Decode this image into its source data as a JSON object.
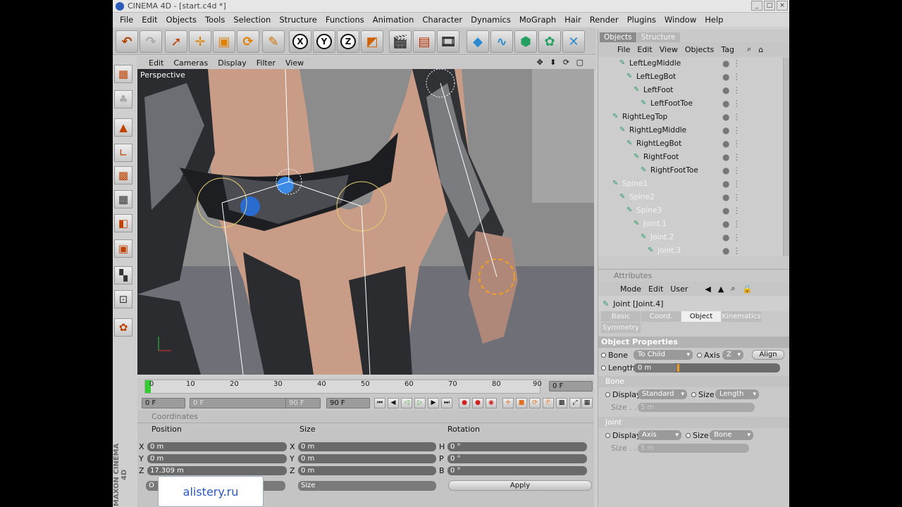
{
  "window": {
    "title": "CINEMA 4D - [start.c4d *]"
  },
  "menu": [
    "File",
    "Edit",
    "Objects",
    "Tools",
    "Selection",
    "Structure",
    "Functions",
    "Animation",
    "Character",
    "Dynamics",
    "MoGraph",
    "Hair",
    "Render",
    "Plugins",
    "Window",
    "Help"
  ],
  "toolbar": {
    "axis_x": "X",
    "axis_y": "Y",
    "axis_z": "Z"
  },
  "viewport": {
    "menu": [
      "Edit",
      "Cameras",
      "Display",
      "Filter",
      "View"
    ],
    "label": "Perspective",
    "nav_icons": "✥ ⬍ ⟳ ▢"
  },
  "timeline": {
    "ticks": [
      "0",
      "10",
      "20",
      "30",
      "40",
      "50",
      "60",
      "70",
      "80",
      "90"
    ],
    "current_frame": "0 F",
    "start": "0 F",
    "range_start": "0 F",
    "range_end": "90 F",
    "end": "90 F"
  },
  "coordinates": {
    "title": "Coordinates",
    "col_position": "Position",
    "col_size": "Size",
    "col_rotation": "Rotation",
    "rows": [
      {
        "pos_label": "X",
        "pos": "0 m",
        "size_label": "X",
        "size": "0 m",
        "rot_label": "H",
        "rot": "0 °"
      },
      {
        "pos_label": "Y",
        "pos": "0 m",
        "size_label": "Y",
        "size": "0 m",
        "rot_label": "P",
        "rot": "0 °"
      },
      {
        "pos_label": "Z",
        "pos": "17.309 m",
        "size_label": "Z",
        "size": "0 m",
        "rot_label": "B",
        "rot": "0 °"
      }
    ],
    "mode_left": "O",
    "mode_size": "Size",
    "apply": "Apply"
  },
  "watermark": "alistery.ru",
  "maxon": "MAXON CINEMA 4D",
  "objects": {
    "tabs": [
      "Objects",
      "Structure"
    ],
    "menu": [
      "File",
      "Edit",
      "View",
      "Objects",
      "Tag"
    ],
    "items": [
      {
        "label": "LeftLegMiddle",
        "depth": 2,
        "faded": false
      },
      {
        "label": "LeftLegBot",
        "depth": 3,
        "faded": false
      },
      {
        "label": "LeftFoot",
        "depth": 4,
        "faded": false
      },
      {
        "label": "LeftFootToe",
        "depth": 5,
        "faded": false
      },
      {
        "label": "RightLegTop",
        "depth": 1,
        "faded": false
      },
      {
        "label": "RightLegMiddle",
        "depth": 2,
        "faded": false
      },
      {
        "label": "RightLegBot",
        "depth": 3,
        "faded": false
      },
      {
        "label": "RightFoot",
        "depth": 4,
        "faded": false
      },
      {
        "label": "RightFootToe",
        "depth": 5,
        "faded": false
      },
      {
        "label": "Spine1",
        "depth": 1,
        "faded": true
      },
      {
        "label": "Spine2",
        "depth": 2,
        "faded": true
      },
      {
        "label": "Spine3",
        "depth": 3,
        "faded": true
      },
      {
        "label": "Joint.1",
        "depth": 4,
        "faded": true
      },
      {
        "label": "Joint.2",
        "depth": 5,
        "faded": true
      },
      {
        "label": "Joint.3",
        "depth": 6,
        "faded": true
      }
    ]
  },
  "attributes": {
    "title": "Attributes",
    "menu": [
      "Mode",
      "Edit",
      "User"
    ],
    "joint_title": "Joint [Joint.4]",
    "tabs": [
      "Basic",
      "Coord.",
      "Object",
      "Kinematics",
      "Symmetry"
    ],
    "active_tab": "Object",
    "section": "Object Properties",
    "bone_label": "Bone",
    "bone_value": "To Child",
    "axis_label": "Axis",
    "axis_value": "Z",
    "align": "Align",
    "length_label": "Length",
    "length_value": "0 m",
    "sub_bone": "Bone",
    "display_label": "Display",
    "display_value": "Standard",
    "size_label": "Size",
    "size_value": "Length",
    "size_dim_label": "Size . .",
    "size_dim_value": "5 m",
    "sub_joint": "Joint",
    "jdisplay_value": "Axis",
    "jsize_value": "Bone",
    "jsize_dim_value": "5 m"
  },
  "colors": {
    "accent_green": "#33cc33",
    "record_red": "#d02020",
    "orange": "#e07020"
  }
}
